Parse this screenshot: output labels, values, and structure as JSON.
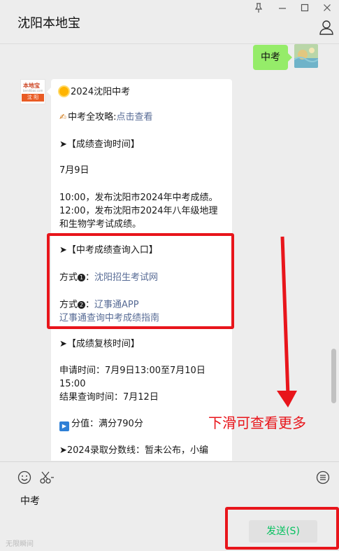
{
  "window": {
    "title": "沈阳本地宝",
    "controls": [
      "pin-icon",
      "minimize-icon",
      "maximize-icon",
      "close-icon"
    ]
  },
  "chat": {
    "me_message": "中考",
    "other_avatar": {
      "top": "本地宝",
      "url": "bendibao.com",
      "bottom": "沈 阳"
    },
    "lines": {
      "l1": "2024沈阳中考",
      "l2_prefix": "中考全攻略:",
      "l2_link": "点击查看",
      "l3": "➤【成绩查询时间】",
      "l4": "7月9日",
      "l5": "10:00，发布沈阳市2024年中考成绩。",
      "l6": "12:00，发布沈阳市2024年八年级地理",
      "l7": "和生物学考试成绩。",
      "l8": "➤【中考成绩查询入口】",
      "l9_prefix": "方式",
      "l9_num": "1",
      "l9_colon": "：",
      "l9_link": "沈阳招生考试网",
      "l10_prefix": "方式",
      "l10_num": "2",
      "l10_colon": "：",
      "l10_link": "辽事通APP",
      "l11_link": "辽事通查询中考成绩指南",
      "l12": "➤【成绩复核时间】",
      "l13": "申请时间：7月9日13:00至7月10日",
      "l14": "15:00",
      "l15": "结果查询时间：7月12日",
      "l16": "分值：满分790分",
      "l17": "➤2024录取分数线：暂未公布，小编"
    },
    "scroll_hint": "下滑可查看更多"
  },
  "input": {
    "text": "中考",
    "send_label": "发送(S)",
    "watermark": "无限瞬间"
  },
  "colors": {
    "accent_red": "#e8151b",
    "link": "#576b95",
    "send_text": "#07c160",
    "bubble_me": "#95ec69"
  }
}
